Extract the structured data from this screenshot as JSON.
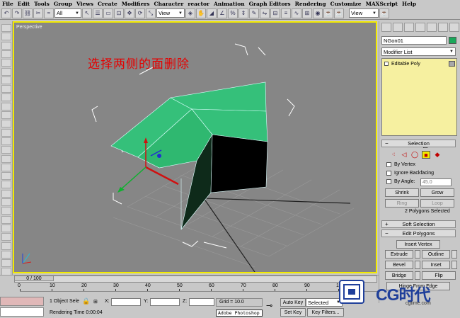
{
  "menu": [
    "File",
    "Edit",
    "Tools",
    "Group",
    "Views",
    "Create",
    "Modifiers",
    "Character",
    "reactor",
    "Animation",
    "Graph Editors",
    "Rendering",
    "Customize",
    "MAXScript",
    "Help"
  ],
  "toolbar": {
    "selection_filter": "All",
    "ref_coord": "View",
    "view_dropdown": "View"
  },
  "viewport": {
    "label": "Perspective",
    "annotation": "选择两侧的面删除"
  },
  "command_panel": {
    "object_name": "NGon01",
    "object_color": "#1aa85a",
    "modifier_list": "Modifier List",
    "stack_item": "Editable Poly",
    "selection": {
      "title": "Selection",
      "by_vertex": "By Vertex",
      "ignore_backfacing": "Ignore Backfacing",
      "by_angle": "By Angle:",
      "angle_value": "45.0",
      "shrink": "Shrink",
      "grow": "Grow",
      "ring": "Ring",
      "loop": "Loop",
      "status": "2 Polygons Selected"
    },
    "soft_selection": "Soft Selection",
    "edit_polygons": {
      "title": "Edit Polygons",
      "insert_vertex": "Insert Vertex",
      "extrude": "Extrude",
      "outline": "Outline",
      "bevel": "Bevel",
      "inset": "Inset",
      "bridge": "Bridge",
      "flip": "Flip",
      "hinge": "Hinge From Edge"
    }
  },
  "timeline": {
    "slider": "0 / 100",
    "ticks": [
      "0",
      "10",
      "20",
      "30",
      "40",
      "50",
      "60",
      "70",
      "80",
      "90",
      "100"
    ]
  },
  "status": {
    "selection": "1 Object Sele",
    "x_label": "X:",
    "y_label": "Y:",
    "z_label": "Z:",
    "grid": "Grid = 10.0",
    "auto_key": "Auto Key",
    "selected": "Selected",
    "set_key": "Set Key",
    "key_filters": "Key Filters...",
    "rendering_time": "Rendering Time  0:00:04",
    "taskbar_app": "Adobe Photoshop"
  },
  "watermark": {
    "brand": "CG时代",
    "url": "cgtime.com"
  }
}
